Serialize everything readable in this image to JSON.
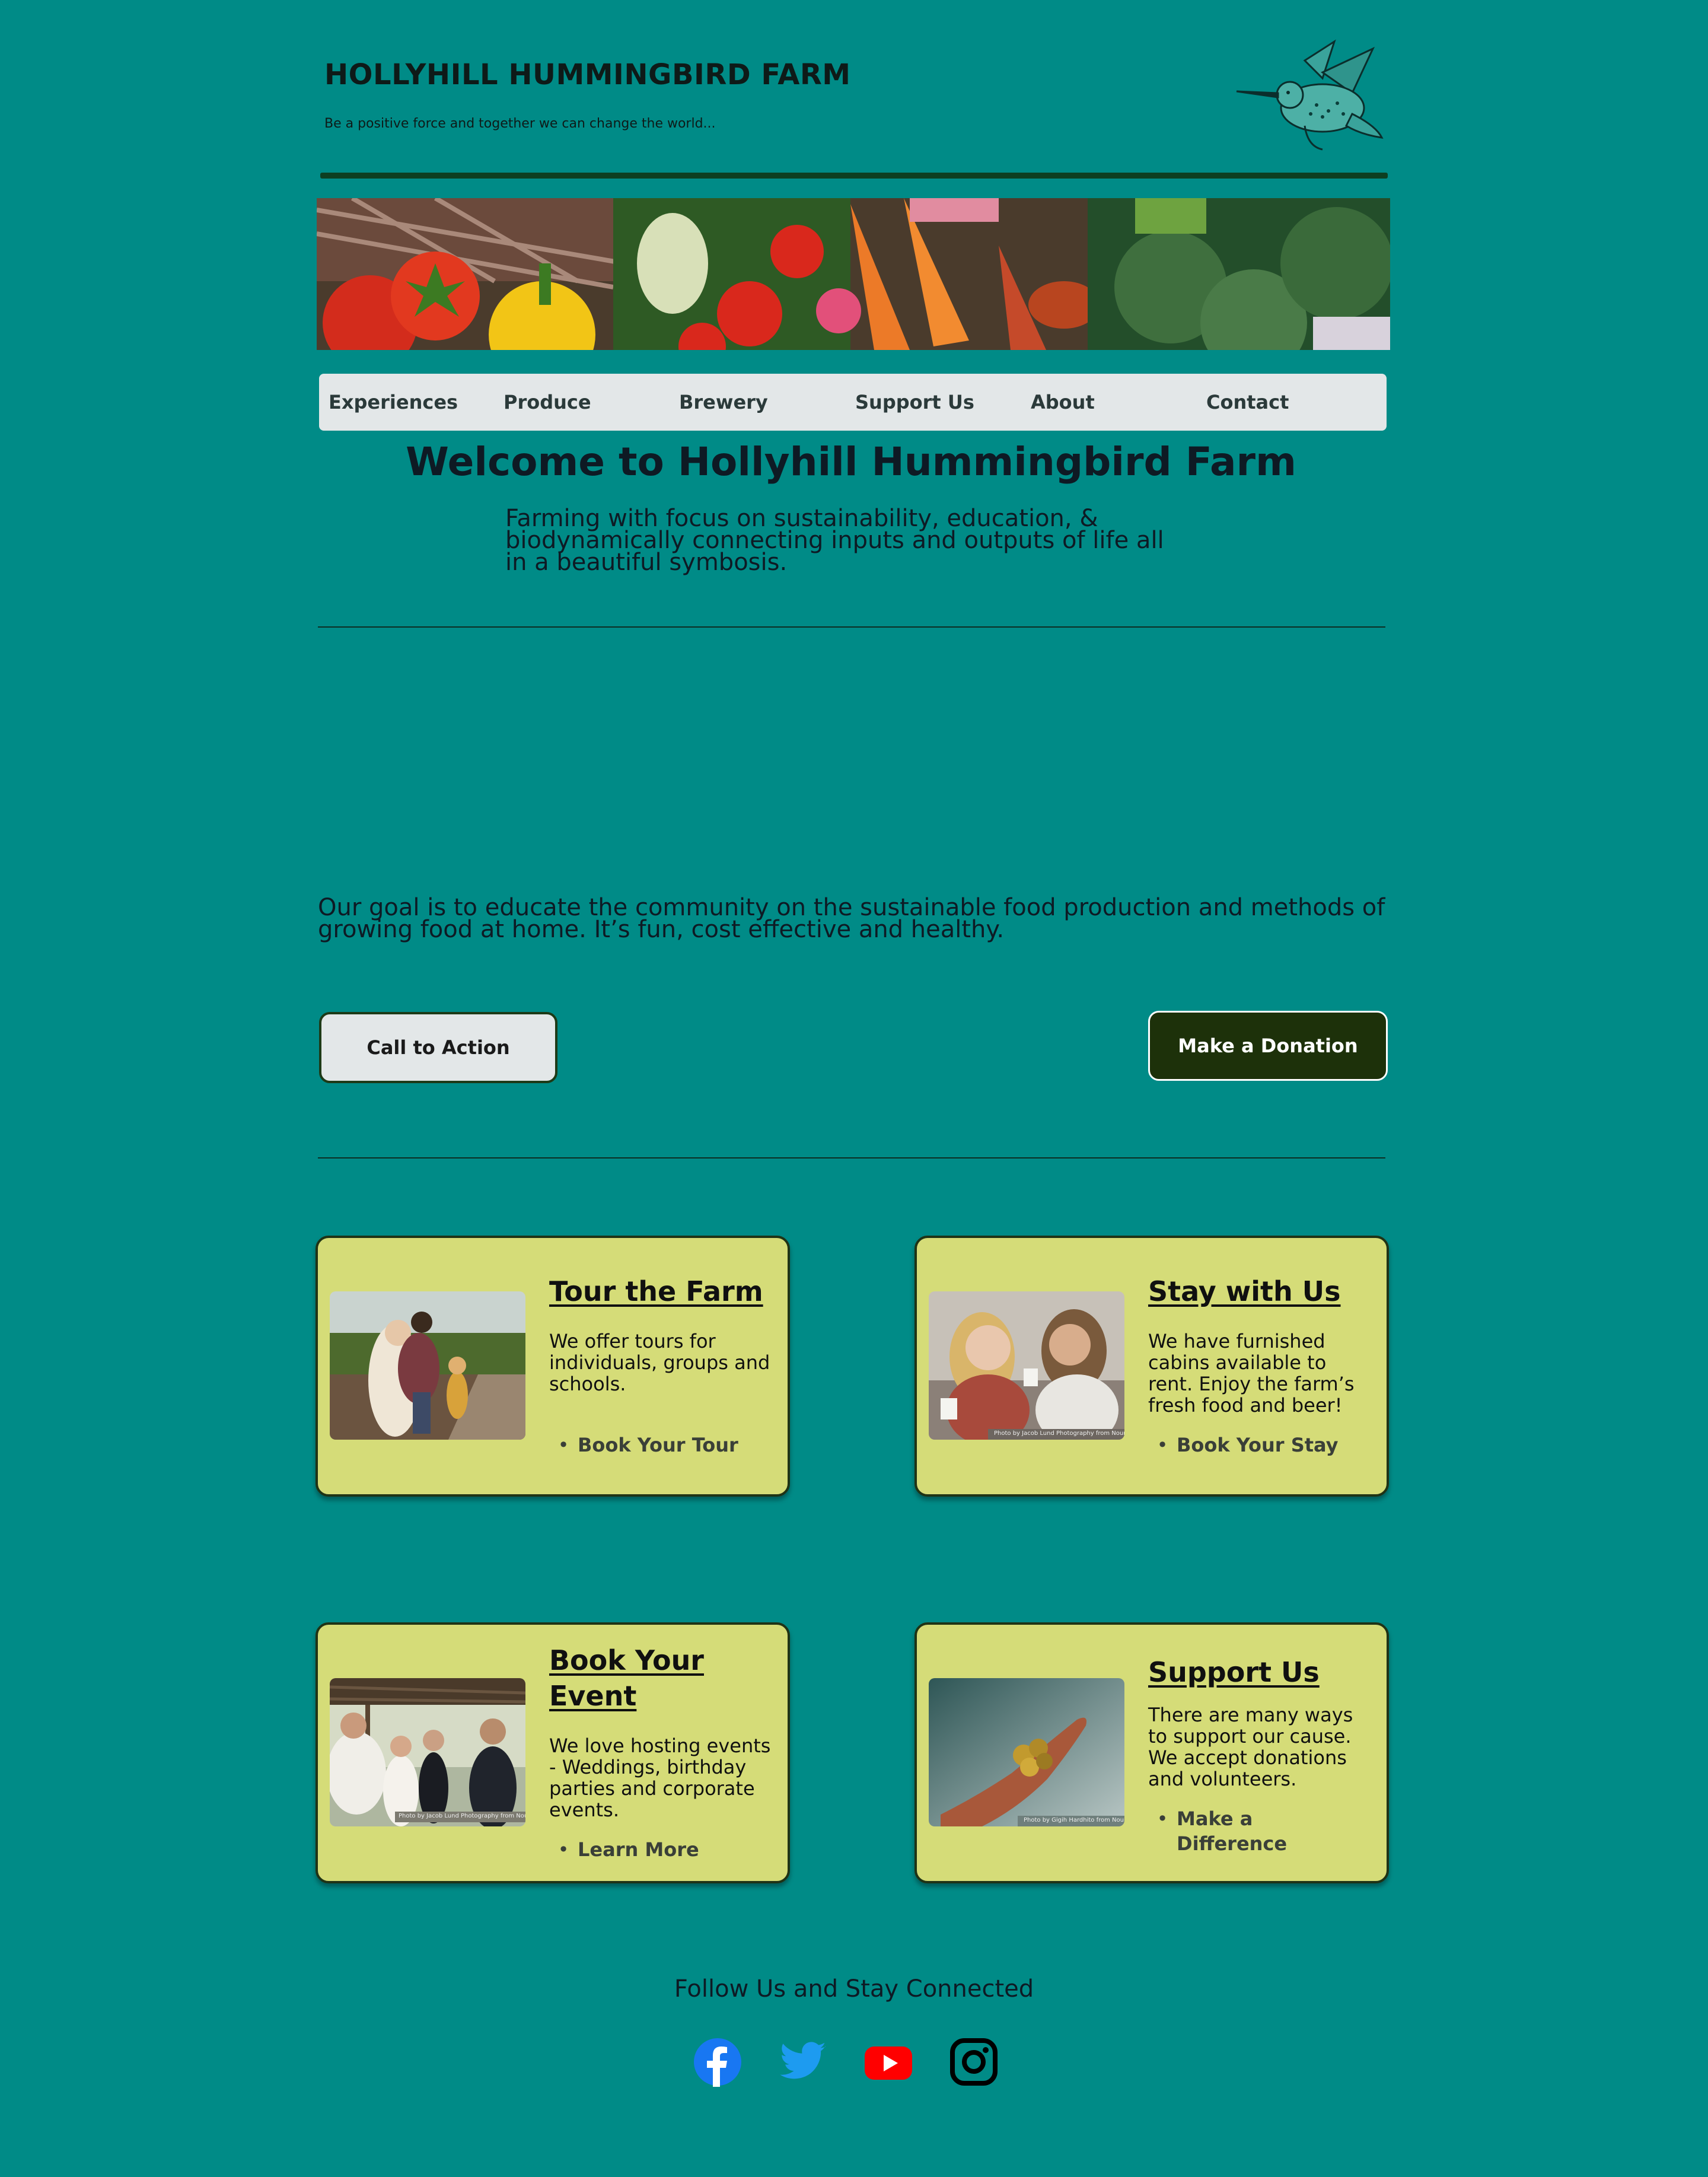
{
  "header": {
    "title": "HOLLYHILL HUMMINGBIRD FARM",
    "tagline": "Be a positive force and together we can change the world...",
    "logo_icon": "hummingbird-logo"
  },
  "nav": {
    "items": [
      "Experiences",
      "Produce",
      "Brewery",
      "Support Us",
      "About",
      "Contact"
    ]
  },
  "welcome": {
    "title": "Welcome to Hollyhill Hummingbird Farm",
    "subtitle": "Farming with focus on sustainability, education, & biodynamically connecting inputs and outputs of life all in a beautiful symbosis."
  },
  "goal": "Our goal is to educate the community on the sustainable food production and methods of growing food at home. It’s fun, cost effective and healthy.",
  "buttons": {
    "cta": "Call to Action",
    "donate": "Make a Donation"
  },
  "cards": [
    {
      "title_lines": [
        "Tour the Farm"
      ],
      "text": "We offer tours for individuals, groups and schools.",
      "link": "Book Your Tour",
      "photo_credit": ""
    },
    {
      "title_lines": [
        "Stay with Us"
      ],
      "text": "We have furnished cabins available to rent. Enjoy the farm’s fresh food and beer!",
      "link": "Book Your Stay",
      "photo_credit": "Photo by Jacob Lund Photography from Noun Pr..."
    },
    {
      "title_lines": [
        "Book Your",
        "Event"
      ],
      "text": "We love hosting events - Weddings, birthday parties and corporate events.",
      "link": "Learn More",
      "photo_credit": "Photo by Jacob Lund Photography from Noun..."
    },
    {
      "title_lines": [
        "Support Us"
      ],
      "text": "There are many ways to support our cause. We accept donations and volunteers.",
      "link_lines": [
        "Make a",
        "Difference"
      ],
      "photo_credit": "Photo by Gigih Hardhito from Noun Pr..."
    }
  ],
  "footer": {
    "follow": "Follow Us and Stay Connected",
    "social": [
      "facebook-icon",
      "twitter-icon",
      "youtube-icon",
      "instagram-icon"
    ]
  },
  "colors": {
    "background": "#008b87",
    "card": "#d5dc78",
    "nav": "#e3e7e8",
    "donate": "#1d310a",
    "facebook": "#1877f2",
    "twitter": "#1d9bf0",
    "youtube": "#ff0000"
  }
}
